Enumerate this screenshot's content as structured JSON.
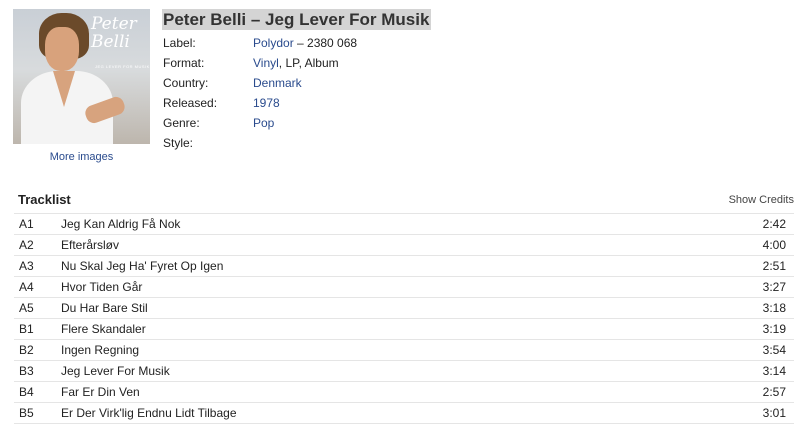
{
  "release": {
    "title": "Peter Belli – Jeg Lever For Musik",
    "cover": {
      "signature_line1": "Peter",
      "signature_line2": "Belli",
      "subtitle": "JEG LEVER FOR MUSIK"
    },
    "more_images": "More images",
    "meta": [
      {
        "key": "Label:",
        "link": "Polydor",
        "rest": " – 2380 068"
      },
      {
        "key": "Format:",
        "link": "Vinyl",
        "rest": ", LP, Album"
      },
      {
        "key": "Country:",
        "link": "Denmark",
        "rest": ""
      },
      {
        "key": "Released:",
        "link": "1978",
        "rest": ""
      },
      {
        "key": "Genre:",
        "link": "Pop",
        "rest": ""
      },
      {
        "key": "Style:",
        "link": "",
        "rest": ""
      }
    ]
  },
  "tracklist": {
    "heading": "Tracklist",
    "show_credits": "Show Credits",
    "tracks": [
      {
        "pos": "A1",
        "title": "Jeg Kan Aldrig Få Nok",
        "duration": "2:42"
      },
      {
        "pos": "A2",
        "title": "Efterårsløv",
        "duration": "4:00"
      },
      {
        "pos": "A3",
        "title": "Nu Skal Jeg Ha' Fyret Op Igen",
        "duration": "2:51"
      },
      {
        "pos": "A4",
        "title": "Hvor Tiden Går",
        "duration": "3:27"
      },
      {
        "pos": "A5",
        "title": "Du Har Bare Stil",
        "duration": "3:18"
      },
      {
        "pos": "B1",
        "title": "Flere Skandaler",
        "duration": "3:19"
      },
      {
        "pos": "B2",
        "title": "Ingen Regning",
        "duration": "3:54"
      },
      {
        "pos": "B3",
        "title": "Jeg Lever For Musik",
        "duration": "3:14"
      },
      {
        "pos": "B4",
        "title": "Far Er Din Ven",
        "duration": "2:57"
      },
      {
        "pos": "B5",
        "title": "Er Der Virk'lig Endnu Lidt Tilbage",
        "duration": "3:01"
      }
    ]
  },
  "colors": {
    "link": "#2a4b8d",
    "title_highlight": "#d4d4d4",
    "row_border": "#e5e5e5"
  }
}
